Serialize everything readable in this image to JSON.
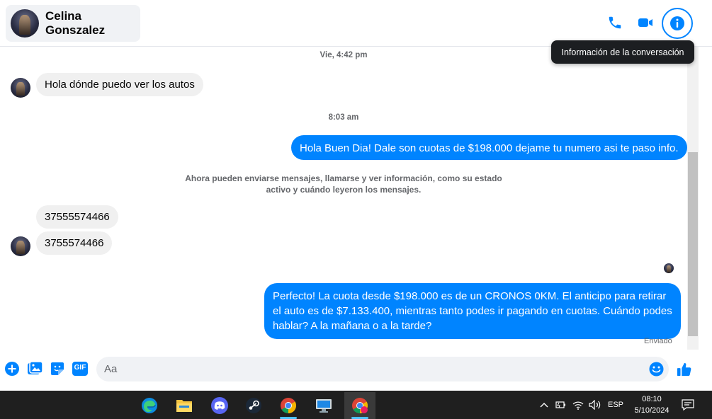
{
  "header": {
    "contact_name": "Celina Gonszalez",
    "tooltip": "Información de la conversación",
    "icons": [
      "phone-icon",
      "video-camera-icon",
      "info-icon"
    ]
  },
  "conversation": {
    "timestamp_1": "Vie, 4:42 pm",
    "incoming_1": "Hola dónde puedo ver los autos",
    "timestamp_2": "8:03 am",
    "outgoing_1": "Hola Buen Dia! Dale son cuotas de $198.000 dejame tu numero asi te paso info.",
    "notice": "Ahora pueden enviarse mensajes, llamarse y ver información, como su estado activo y cuándo leyeron los mensajes.",
    "incoming_2": "37555574466",
    "incoming_3": "3755574466",
    "outgoing_2": "Perfecto! La cuota desde $198.000 es de un CRONOS 0KM. El anticipo para retirar el auto es de $7.133.400, mientras tanto podes ir pagando en cuotas. Cuándo podes hablar? A la mañana o a la tarde?",
    "status": "Enviado"
  },
  "composer": {
    "placeholder": "Aa",
    "icons": [
      "plus-circle-icon",
      "image-icon",
      "sticker-icon",
      "gif-icon",
      "emoji-icon",
      "thumbs-up-icon"
    ],
    "gif_label": "GIF"
  },
  "taskbar": {
    "apps": [
      "edge-icon",
      "file-explorer-icon",
      "discord-icon",
      "steam-icon",
      "chrome-icon",
      "remote-desktop-icon",
      "chrome-profile-icon"
    ],
    "language": "ESP",
    "time": "08:10",
    "date": "5/10/2024"
  },
  "colors": {
    "accent": "#0084ff",
    "incoming_bubble": "#f0f0f0",
    "taskbar": "#1f1f1f"
  }
}
